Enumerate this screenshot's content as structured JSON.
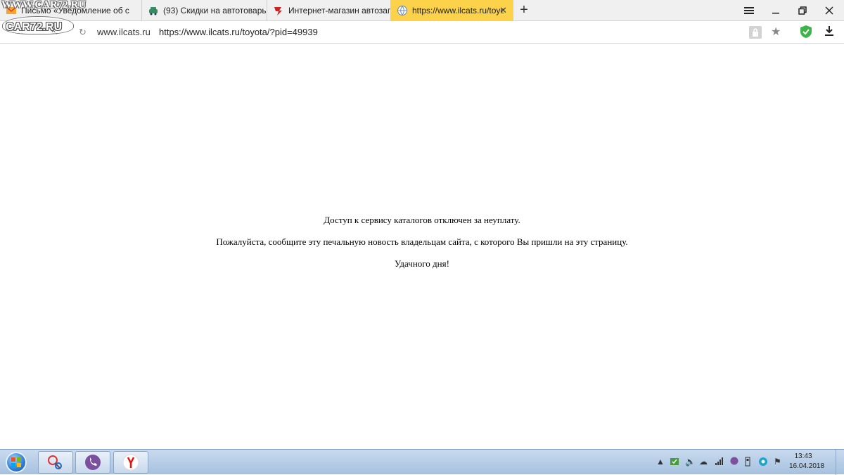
{
  "watermark": {
    "site": "WWW.CAR72.RU",
    "logo": "CAR72.RU"
  },
  "tabs": [
    {
      "title": "Письмо «Уведомление об с"
    },
    {
      "title": "(93) Скидки на автотовары"
    },
    {
      "title": "Интернет-магазин автозап"
    },
    {
      "title": "https://www.ilcats.ru/toyo"
    }
  ],
  "address_bar": {
    "domain": "www.ilcats.ru",
    "url": "https://www.ilcats.ru/toyota/?pid=49939"
  },
  "page": {
    "line1": "Доступ к сервису каталогов отключен за неуплату.",
    "line2": "Пожалуйста, сообщите эту печальную новость владельцам сайта, с которого Вы пришли на эту страницу.",
    "line3": "Удачного дня!"
  },
  "taskbar": {
    "clock_time": "13:43",
    "clock_date": "16.04.2018"
  },
  "colors": {
    "active_tab": "#fbd24a",
    "taskbar": "#b8cfe8",
    "shield": "#3cb44a"
  }
}
